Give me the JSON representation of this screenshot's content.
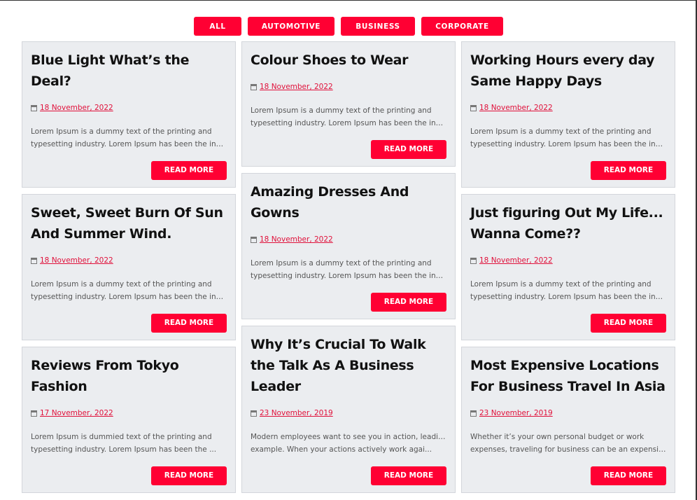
{
  "filters": [
    "ALL",
    "AUTOMOTIVE",
    "BUSINESS",
    "CORPORATE"
  ],
  "read_more_label": "READ MORE",
  "columns": [
    [
      {
        "title": "Blue Light What’s the Deal?",
        "date": "18 November, 2022",
        "excerpt": [
          "Lorem Ipsum is a dummy text of the printing and",
          "typesetting industry. Lorem Ipsum has been the indu..."
        ]
      },
      {
        "title": "Sweet, Sweet Burn Of Sun And Summer Wind.",
        "date": "18 November, 2022",
        "excerpt": [
          "Lorem Ipsum is a dummy text of the printing and",
          "typesetting industry. Lorem Ipsum has been the indu..."
        ]
      },
      {
        "title": "Reviews From Tokyo Fashion",
        "date": "17 November, 2022",
        "excerpt": [
          "Lorem Ipsum is dummied text of the printing and",
          "typesetting industry. Lorem Ipsum has been the ..."
        ]
      }
    ],
    [
      {
        "title": "Colour Shoes to Wear",
        "date": "18 November, 2022",
        "excerpt": [
          "Lorem Ipsum is a dummy text of the printing and",
          "typesetting industry. Lorem Ipsum has been the indu..."
        ]
      },
      {
        "title": "Amazing Dresses And Gowns",
        "date": "18 November, 2022",
        "excerpt": [
          "Lorem Ipsum is a dummy text of the printing and",
          "typesetting industry. Lorem Ipsum has been the indu..."
        ]
      },
      {
        "title": "Why It’s Crucial To Walk the Talk As A Business Leader",
        "date": "23 November, 2019",
        "excerpt": [
          "Modern employees want to see you in action, leading by",
          "example. When your actions actively work agai..."
        ]
      }
    ],
    [
      {
        "title": "Working Hours every day Same Happy Days",
        "date": "18 November, 2022",
        "excerpt": [
          "Lorem Ipsum is a dummy text of the printing and",
          "typesetting industry. Lorem Ipsum has been the indu..."
        ]
      },
      {
        "title": "Just figuring Out My Life... Wanna Come??",
        "date": "18 November, 2022",
        "excerpt": [
          "Lorem Ipsum is a dummy text of the printing and",
          "typesetting industry. Lorem Ipsum has been the indu..."
        ]
      },
      {
        "title": "Most Expensive Locations For Business Travel In Asia",
        "date": "23 November, 2019",
        "excerpt": [
          "Whether it’s your own personal budget or work",
          "expenses, traveling for business can be an expensive..."
        ]
      }
    ]
  ]
}
